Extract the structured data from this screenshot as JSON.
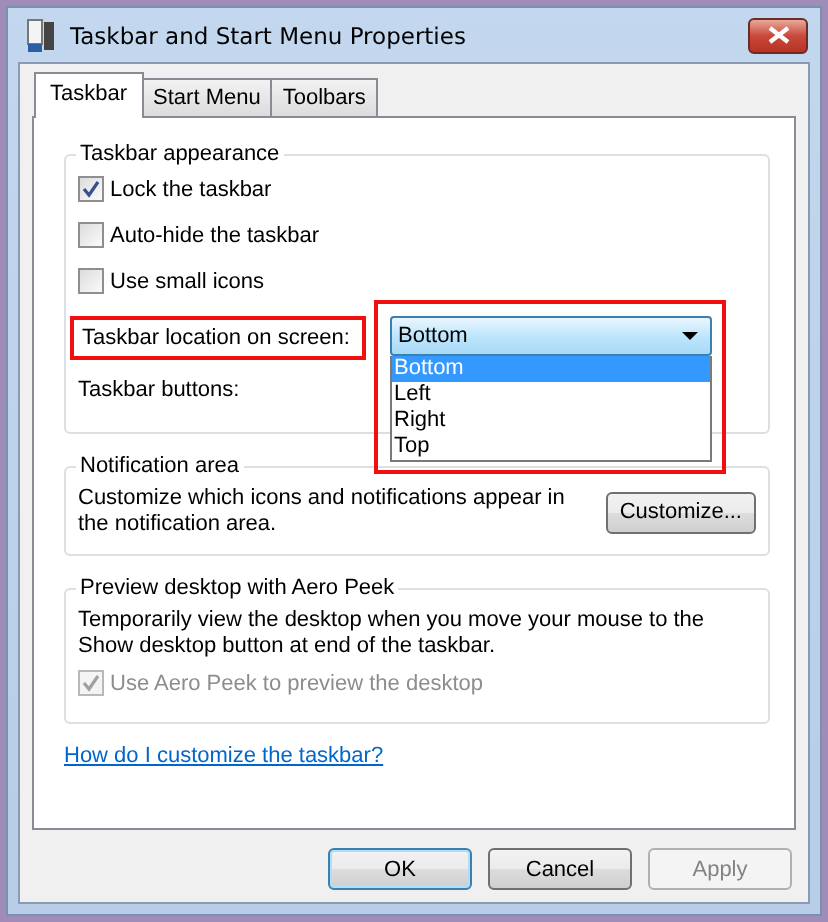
{
  "window": {
    "title": "Taskbar and Start Menu Properties"
  },
  "tabs": [
    {
      "label": "Taskbar",
      "selected": true
    },
    {
      "label": "Start Menu",
      "selected": false
    },
    {
      "label": "Toolbars",
      "selected": false
    }
  ],
  "appearance": {
    "legend": "Taskbar appearance",
    "options": [
      {
        "label": "Lock the taskbar",
        "checked": true
      },
      {
        "label": "Auto-hide the taskbar",
        "checked": false
      },
      {
        "label": "Use small icons",
        "checked": false
      }
    ],
    "location": {
      "label": "Taskbar location on screen:",
      "highlighted": true,
      "value": "Bottom",
      "expanded": true,
      "options": [
        {
          "label": "Bottom",
          "selected": true
        },
        {
          "label": "Left",
          "selected": false
        },
        {
          "label": "Right",
          "selected": false
        },
        {
          "label": "Top",
          "selected": false
        }
      ]
    },
    "buttons_label": "Taskbar buttons:"
  },
  "notification": {
    "legend": "Notification area",
    "text": "Customize which icons and notifications appear in the notification area.",
    "button": "Customize..."
  },
  "aero": {
    "legend": "Preview desktop with Aero Peek",
    "text": "Temporarily view the desktop when you move your mouse to the Show desktop button at end of the taskbar.",
    "option": {
      "label": "Use Aero Peek to preview the desktop",
      "checked": true,
      "disabled": true
    }
  },
  "help_link": "How do I customize the taskbar?",
  "buttons": [
    {
      "label": "OK",
      "default": true,
      "disabled": false
    },
    {
      "label": "Cancel",
      "default": false,
      "disabled": false
    },
    {
      "label": "Apply",
      "default": false,
      "disabled": true
    }
  ]
}
